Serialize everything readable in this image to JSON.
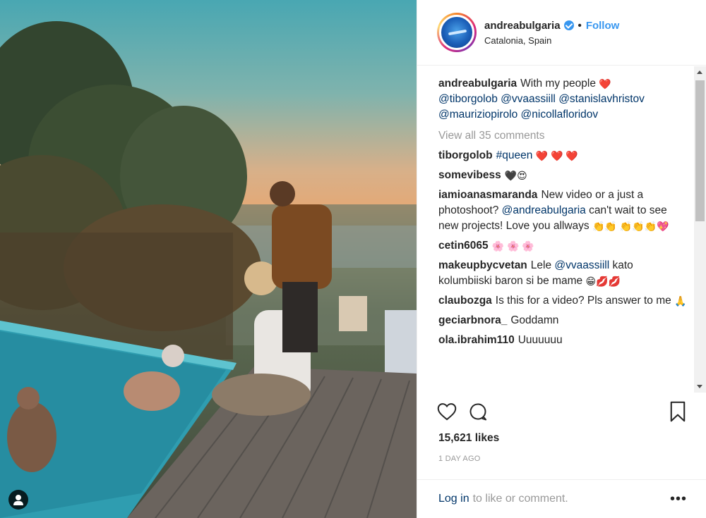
{
  "header": {
    "username": "andreabulgaria",
    "separator": "•",
    "follow_label": "Follow",
    "location": "Catalonia, Spain"
  },
  "caption": {
    "username": "andreabulgaria",
    "text": "With my people",
    "emoji": "❤️",
    "mentions": [
      "@tiborgolob",
      "@vvaassiill",
      "@stanislavhristov",
      "@mauriziopirolo",
      "@nicollafloridov"
    ]
  },
  "view_all_label": "View all 35 comments",
  "comments": [
    {
      "user": "tiborgolob",
      "mention": "#queen",
      "text": "",
      "emoji": "❤️ ❤️ ❤️"
    },
    {
      "user": "somevibess",
      "text": "",
      "emoji": "🖤😍"
    },
    {
      "user": "iamioanasmaranda",
      "text_before": "New video or a just a photoshoot?",
      "mention": "@andreabulgaria",
      "text_after": "can't wait to see new projects! Love you allways",
      "emoji": "👏👏 👏👏👏💖"
    },
    {
      "user": "cetin6065",
      "text": "",
      "emoji": "🌸 🌸 🌸"
    },
    {
      "user": "makeupbycvetan",
      "text_before": "Lele",
      "mention": "@vvaassiill",
      "text_after": "kato kolumbiiski baron si be mame",
      "emoji": "😁💋💋"
    },
    {
      "user": "claubozga",
      "text": "Is this for a video? Pls answer to me",
      "emoji": "🙏"
    },
    {
      "user": "geciarbnora_",
      "text": "Goddamn",
      "emoji": ""
    },
    {
      "user": "ola.ibrahim110",
      "text": "Uuuuuuu",
      "emoji": ""
    }
  ],
  "likes": "15,621 likes",
  "date": "1 DAY AGO",
  "footer": {
    "login_label": "Log in",
    "rest": "to like or comment.",
    "more": "•••"
  },
  "icons": [
    "heart-icon",
    "comment-icon",
    "bookmark-icon",
    "tag-user-icon",
    "verified-icon",
    "more-options-icon"
  ],
  "colors": {
    "link": "#003569",
    "follow": "#3897f0",
    "muted": "#999999",
    "heart": "#e0245e"
  }
}
